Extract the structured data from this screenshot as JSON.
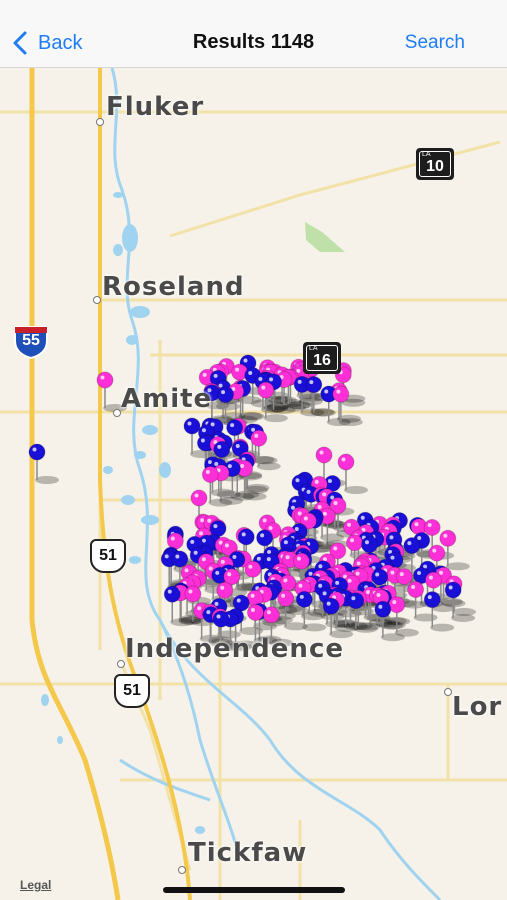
{
  "nav": {
    "back_label": "Back",
    "title": "Results 1148",
    "search_label": "Search"
  },
  "map": {
    "towns": [
      {
        "id": "fluker",
        "name": "Fluker"
      },
      {
        "id": "roseland",
        "name": "Roseland"
      },
      {
        "id": "amite",
        "name": "Amite"
      },
      {
        "id": "independence",
        "name": "Independence"
      },
      {
        "id": "tickfaw",
        "name": "Tickfaw"
      },
      {
        "id": "loranger",
        "name": "Lor"
      }
    ],
    "shields": {
      "la10": {
        "type": "LA",
        "prefix": "LA",
        "number": "10"
      },
      "la16": {
        "type": "LA",
        "prefix": "LA",
        "number": "16"
      },
      "i55": {
        "type": "Interstate",
        "number": "55"
      },
      "us51_a": {
        "type": "US",
        "number": "51"
      },
      "us51_b": {
        "type": "US",
        "number": "51"
      }
    },
    "legal_label": "Legal",
    "pin_colors": {
      "magenta": "#ff2fd8",
      "blue": "#1a0fd6"
    },
    "colors": {
      "land": "#f6f2e9",
      "water": "#9fd3f0",
      "highway": "#f3c84b",
      "minor_road": "#f3e2a8",
      "park": "#bfe0a8"
    }
  }
}
